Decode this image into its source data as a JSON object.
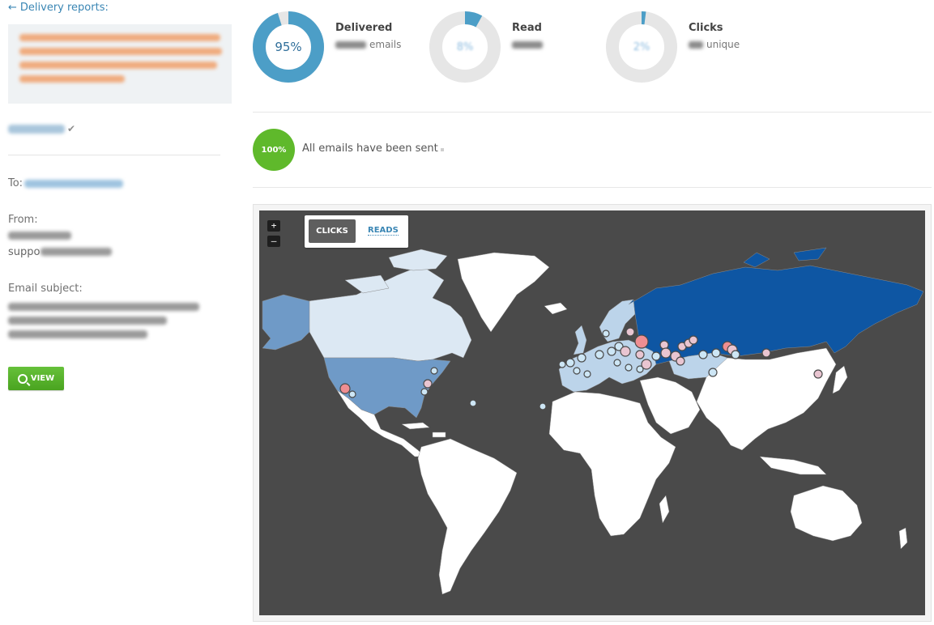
{
  "nav": {
    "back_label": "Delivery reports:"
  },
  "recipient": {
    "label": "To:"
  },
  "sender": {
    "label": "From:",
    "email_prefix": "suppo"
  },
  "subject": {
    "label": "Email subject:"
  },
  "view_button": {
    "label": "VIEW"
  },
  "stats": [
    {
      "title": "Delivered",
      "center": "95%",
      "suffix": "emails",
      "fraction": 0.95,
      "color": "#4c9ec7"
    },
    {
      "title": "Read",
      "center": "8%",
      "suffix": "",
      "fraction": 0.08,
      "color": "#4c9ec7"
    },
    {
      "title": "Clicks",
      "center": "2%",
      "suffix": "unique",
      "fraction": 0.02,
      "color": "#4c9ec7"
    }
  ],
  "sending": {
    "percent": "100%",
    "message": "All emails have been sent"
  },
  "map": {
    "zoom_in": "+",
    "zoom_out": "–",
    "tabs": {
      "clicks": "CLICKS",
      "reads": "READS"
    },
    "colors": {
      "ocean": "#4a4a4a",
      "land": "#ffffff",
      "russia": "#0e56a3",
      "usa": "#6f9ac7",
      "canada": "#dce8f3",
      "europe": "#bcd4ea",
      "kazakhstan": "#bcd4ea",
      "marker_high": "#ef8e92",
      "marker_mid": "#e9c5d1",
      "marker_low": "#cde6f5"
    }
  }
}
